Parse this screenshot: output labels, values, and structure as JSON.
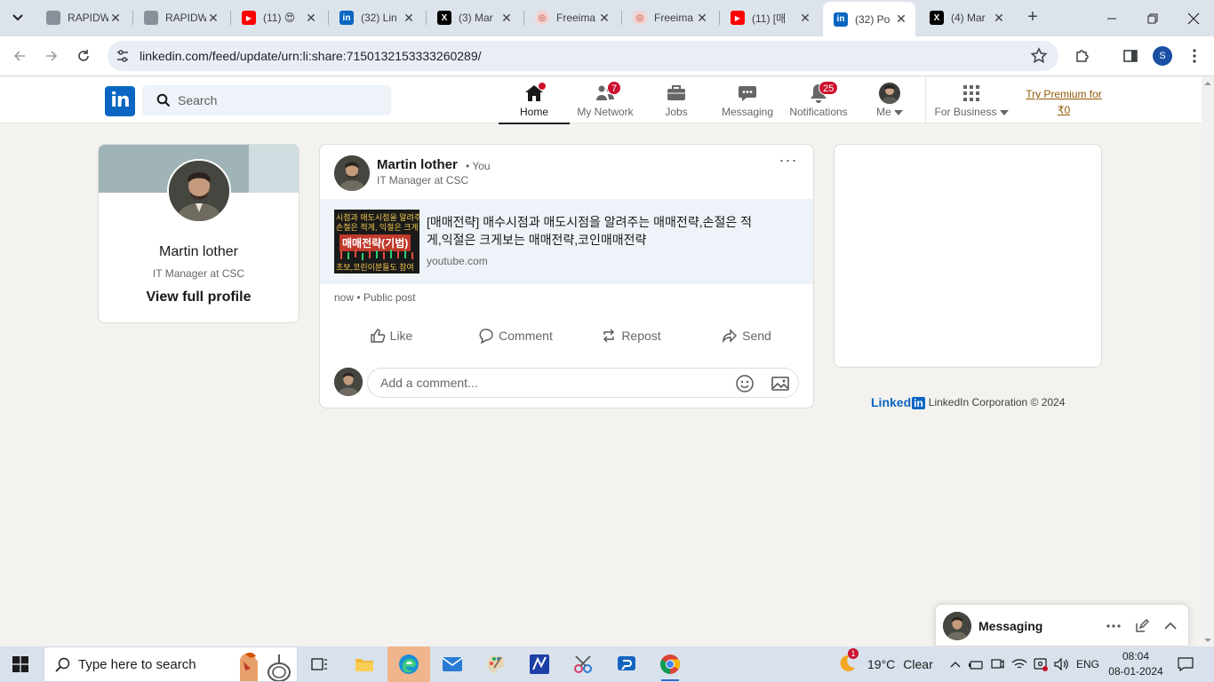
{
  "browser": {
    "tabs": [
      {
        "title": "RAPIDW",
        "favicon": "globe-gray"
      },
      {
        "title": "RAPIDW",
        "favicon": "globe-gray"
      },
      {
        "title": "(11) 😍",
        "favicon": "youtube"
      },
      {
        "title": "(32) Lin",
        "favicon": "linkedin"
      },
      {
        "title": "(3) Mar",
        "favicon": "x"
      },
      {
        "title": "Freeima",
        "favicon": "freeimage"
      },
      {
        "title": "Freeima",
        "favicon": "freeimage"
      },
      {
        "title": "(11) [매",
        "favicon": "youtube"
      },
      {
        "title": "(32) Po",
        "favicon": "linkedin",
        "active": true
      },
      {
        "title": "(4) Mar",
        "favicon": "x"
      }
    ],
    "url": "linkedin.com/feed/update/urn:li:share:7150132153333260289/",
    "profile_initial": "S"
  },
  "linkedin": {
    "logo": "in",
    "search_placeholder": "Search",
    "nav": {
      "home": "Home",
      "network": "My Network",
      "network_badge": "7",
      "jobs": "Jobs",
      "messaging": "Messaging",
      "notifications": "Notifications",
      "notifications_badge": "25",
      "me": "Me",
      "business": "For Business",
      "premium": "Try Premium for ₹0"
    },
    "profile": {
      "name": "Martin lother",
      "headline": "IT Manager at CSC",
      "view_link": "View full profile"
    },
    "post": {
      "author": "Martin lother",
      "you": "• You",
      "headline": "IT Manager at CSC",
      "more": "···",
      "link_title": "[매매전략] 매수시점과 매도시점을 알려주는 매매전략,손절은 적게,익절은 크게보는 매매전략,코인매매전략",
      "link_domain": "youtube.com",
      "thumb_line1": "시점과 매도시점을 알려주",
      "thumb_line2": "손절은 적게, 익절은 크게",
      "thumb_banner": "매매전략(기법)",
      "thumb_line3": "초보,코린이분들도 참여",
      "meta": "now • Public post",
      "actions": {
        "like": "Like",
        "comment": "Comment",
        "repost": "Repost",
        "send": "Send"
      },
      "comment_placeholder": "Add a comment..."
    },
    "footer": {
      "brand": "Linked",
      "brand_in": "in",
      "copyright": "LinkedIn Corporation © 2024"
    },
    "messaging": {
      "title": "Messaging"
    }
  },
  "taskbar": {
    "search_placeholder": "Type here to search",
    "weather_temp": "19°C",
    "weather_cond": "Clear",
    "weather_badge": "1",
    "language": "ENG",
    "time": "08:04",
    "date": "08-01-2024"
  },
  "colors": {
    "linkedin_blue": "#0a66c2",
    "badge_red": "#cb112d",
    "premium_gold": "#915907",
    "page_bg": "#f4f2ee"
  }
}
